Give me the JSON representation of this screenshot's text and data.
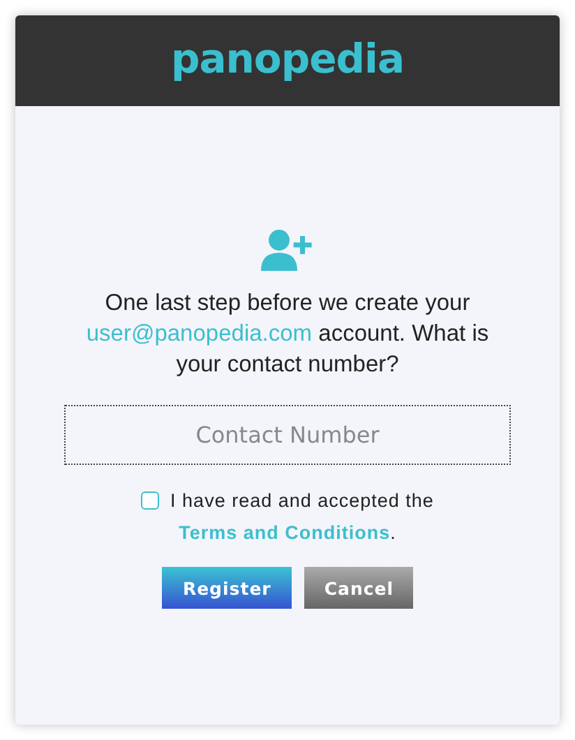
{
  "brand": {
    "logo": "panopedia"
  },
  "prompt": {
    "before": "One last step before we create your",
    "email": "user@panopedia.com",
    "after": "account. What is your contact number?"
  },
  "contact_field": {
    "placeholder": "Contact Number"
  },
  "terms": {
    "checked": false,
    "before": "I have read and accepted the",
    "link": "Terms and Conditions",
    "after": "."
  },
  "buttons": [
    {
      "label": "Register",
      "kind": "primary"
    },
    {
      "label": "Cancel",
      "kind": "secondary"
    }
  ]
}
